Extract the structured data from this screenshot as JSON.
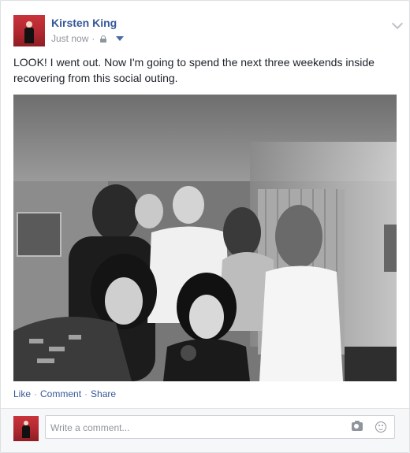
{
  "post": {
    "author": "Kirsten King",
    "timestamp": "Just now",
    "separator": "·",
    "privacy_icon": "lock-icon",
    "audience_icon": "caret-down-icon",
    "menu_icon": "chevron-down-icon",
    "text": "LOOK! I went out. Now I'm going to spend the next three weekends inside recovering from this social outing."
  },
  "actions": {
    "like": "Like",
    "comment": "Comment",
    "share": "Share",
    "separator": "·"
  },
  "comment_box": {
    "placeholder": "Write a comment...",
    "camera_icon": "camera-icon",
    "emoji_icon": "smiley-icon"
  },
  "colors": {
    "link": "#365899",
    "meta": "#90949c",
    "text": "#1d2129"
  }
}
